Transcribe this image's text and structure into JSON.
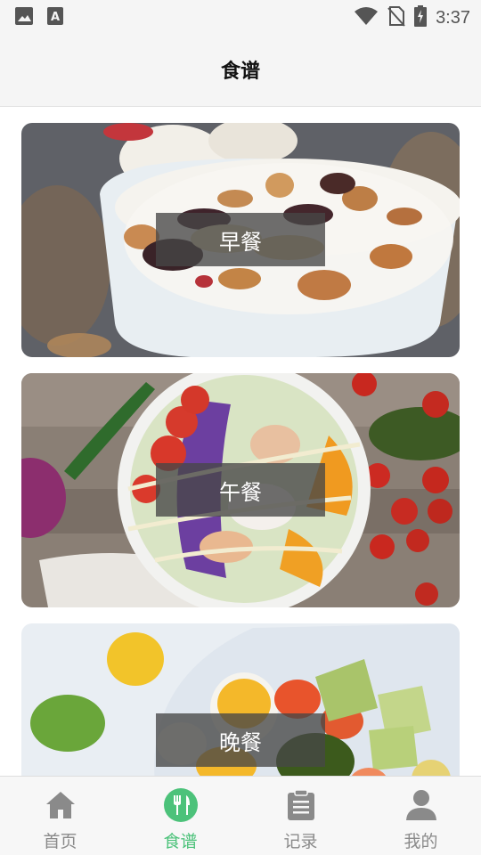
{
  "status_bar": {
    "time": "3:37",
    "left_icons": [
      "image-icon",
      "text-a-icon"
    ],
    "right_icons": [
      "wifi-icon",
      "no-sim-icon",
      "battery-charging-icon"
    ]
  },
  "header": {
    "title": "食谱"
  },
  "cards": [
    {
      "label": "早餐"
    },
    {
      "label": "午餐"
    },
    {
      "label": "晚餐"
    }
  ],
  "bottom_nav": {
    "active_color": "#4cc27a",
    "inactive_color": "#8a8a8a",
    "items": [
      {
        "label": "首页",
        "icon": "home-icon",
        "active": false
      },
      {
        "label": "食谱",
        "icon": "utensils-icon",
        "active": true
      },
      {
        "label": "记录",
        "icon": "clipboard-icon",
        "active": false
      },
      {
        "label": "我的",
        "icon": "person-icon",
        "active": false
      }
    ]
  }
}
